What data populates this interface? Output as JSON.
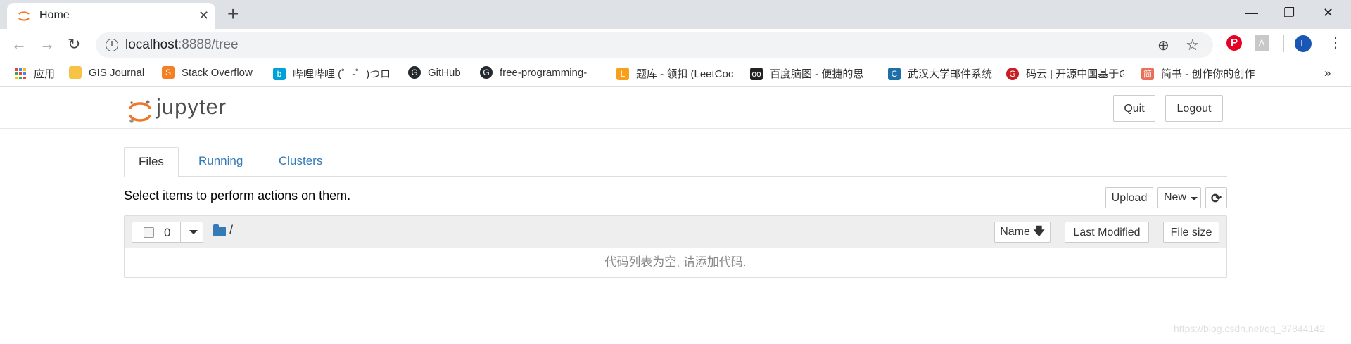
{
  "browser": {
    "tab_title": "Home",
    "url_host": "localhost",
    "url_rest": ":8888/tree",
    "avatar_letter": "L",
    "tab_close_glyph": "✕",
    "new_tab_glyph": "+",
    "window_controls": {
      "minimize": "—",
      "restore": "❐",
      "close": "✕"
    },
    "nav": {
      "back": "←",
      "forward": "→",
      "reload": "↻"
    },
    "zoom_glyph": "⊕",
    "star_glyph": "☆",
    "menu_glyph": "⋮",
    "pinterest_letter": "P",
    "pdf_letter": "A"
  },
  "bookmarks": [
    {
      "label": "应用",
      "icon": "apps-icon",
      "color": "#4285f4"
    },
    {
      "label": "GIS Journal",
      "icon": "folder-icon",
      "color": "#f6c344"
    },
    {
      "label": "Stack Overflow",
      "icon": "stackoverflow-icon",
      "color": "#f48024"
    },
    {
      "label": "哔哩哔哩 (゜-゜)つロ",
      "icon": "bilibili-icon",
      "color": "#00a1d6"
    },
    {
      "label": "GitHub",
      "icon": "github-icon",
      "color": "#24292e"
    },
    {
      "label": "free-programming-",
      "icon": "github-icon",
      "color": "#24292e"
    },
    {
      "label": "题库 - 领扣 (LeetCoc",
      "icon": "leetcode-icon",
      "color": "#f89f1b"
    },
    {
      "label": "百度脑图 - 便捷的思",
      "icon": "owl-icon",
      "color": "#222222"
    },
    {
      "label": "武汉大学邮件系统",
      "icon": "mail-icon",
      "color": "#1e6fa8"
    },
    {
      "label": "码云 | 开源中国基于G",
      "icon": "gitee-icon",
      "color": "#c71d23"
    },
    {
      "label": "简书 - 创作你的创作",
      "icon": "jianshu-icon",
      "color": "#ea6f5a"
    }
  ],
  "bookmarks_more": "»",
  "jupyter": {
    "logo_text": "jupyter",
    "quit_label": "Quit",
    "logout_label": "Logout",
    "tabs": [
      {
        "label": "Files",
        "active": true
      },
      {
        "label": "Running",
        "active": false
      },
      {
        "label": "Clusters",
        "active": false
      }
    ],
    "instruction": "Select items to perform actions on them.",
    "upload_label": "Upload",
    "new_label": "New",
    "refresh_glyph": "⟳",
    "selected_count": "0",
    "breadcrumb": "/",
    "sort_name_label": "Name",
    "sort_arrow": "🡇",
    "last_modified_label": "Last Modified",
    "file_size_label": "File size",
    "empty_message": "代码列表为空, 请添加代码."
  },
  "watermark": "https://blog.csdn.net/qq_37844142"
}
